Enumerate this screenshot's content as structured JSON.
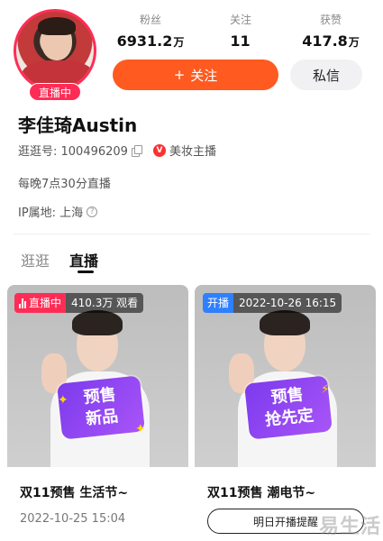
{
  "profile": {
    "live_badge": "直播中",
    "name": "李佳琦Austin",
    "id_text": "逛逛号: 100496209",
    "verify_text": "美妆主播",
    "description": "每晚7点30分直播",
    "ip_text": "IP属地: 上海"
  },
  "stats": [
    {
      "label": "粉丝",
      "value": "6931.2",
      "unit": "万"
    },
    {
      "label": "关注",
      "value": "11",
      "unit": ""
    },
    {
      "label": "获赞",
      "value": "417.8",
      "unit": "万"
    }
  ],
  "actions": {
    "follow_label": "关注",
    "follow_plus": "+",
    "message_label": "私信"
  },
  "tabs": [
    {
      "label": "逛逛",
      "active": false
    },
    {
      "label": "直播",
      "active": true
    }
  ],
  "cards": [
    {
      "badge": "直播中",
      "viewers": "410.3万 观看",
      "promo_lines": [
        "预售",
        "新品"
      ],
      "title": "双11预售 生活节~",
      "time": "2022-10-25 15:04"
    },
    {
      "badge": "开播",
      "schedule": "2022-10-26 16:15",
      "promo_lines": [
        "预售",
        "抢先定"
      ],
      "title": "双11预售 潮电节~",
      "remind_label": "明日开播提醒"
    }
  ],
  "watermark": "易生活",
  "colors": {
    "accent": "#ff5a1f",
    "live": "#ff2d55",
    "scheduled": "#2f80ff",
    "promo": "#8b3dff"
  }
}
